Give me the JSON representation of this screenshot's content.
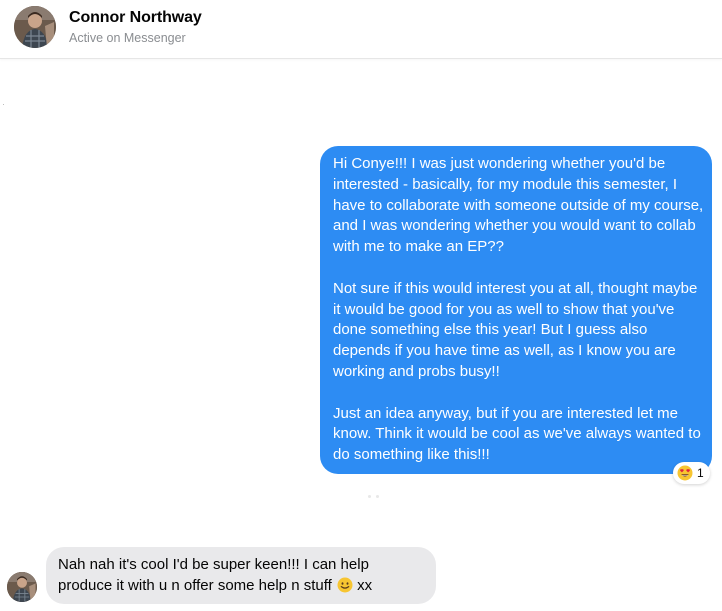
{
  "header": {
    "contact_name": "Connor Northway",
    "status": "Active on Messenger",
    "avatar_icon": "avatar-icon"
  },
  "conversation": {
    "outgoing": {
      "paragraphs": [
        "Hi Conye!!! I was just wondering whether you'd be interested - basically, for my module this semester, I have to collaborate with someone outside of my course, and I was wondering whether you would want to collab with me to make an EP??",
        "Not sure if this would interest you at all, thought maybe it would be good for you as well to show that you've done something else this year! But I guess also depends if you have time as well, as I know you are working and probs busy!!",
        "Just an idea anyway, but if you are interested let me know. Think it would be cool as we've always wanted to do something like this!!!"
      ],
      "bubble_color": "#2d8cf3",
      "reaction": {
        "icon": "heart-eyes-emoji-icon",
        "count": "1"
      }
    },
    "incoming": {
      "text": "Nah nah it's cool I'd be super keen!!! I can help produce it with u n offer some help n stuff",
      "emoji_icon": "smiling-face-emoji-icon",
      "text_after_emoji": " xx",
      "bubble_color": "#e9e9eb"
    }
  }
}
